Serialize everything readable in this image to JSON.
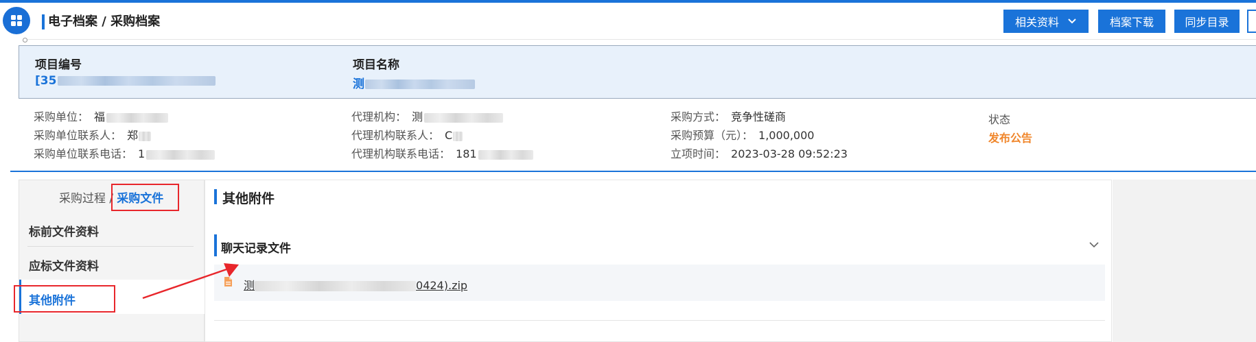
{
  "header": {
    "breadcrumb": "电子档案 / 采购档案",
    "buttons": {
      "related": "相关资料",
      "download": "档案下载",
      "sync": "同步目录"
    }
  },
  "project": {
    "number_label": "项目编号",
    "number_value": "[35",
    "name_label": "项目名称",
    "name_value": "测"
  },
  "info": {
    "purchaser_label": "采购单位：",
    "purchaser_value": "福",
    "purchaser_contact_label": "采购单位联系人：",
    "purchaser_contact_value": "郑",
    "purchaser_phone_label": "采购单位联系电话：",
    "purchaser_phone_value": "1",
    "agency_label": "代理机构：",
    "agency_value": "测",
    "agency_contact_label": "代理机构联系人：",
    "agency_contact_value": "C",
    "agency_phone_label": "代理机构联系电话：",
    "agency_phone_value": "181",
    "method_label": "采购方式：",
    "method_value": "竞争性磋商",
    "budget_label": "采购预算（元）：",
    "budget_value": "1,000,000",
    "date_label": "立项时间：",
    "date_value": "2023-03-28 09:52:23",
    "status_label": "状态",
    "status_value": "发布公告"
  },
  "left_panel": {
    "path": "采购过程 /",
    "active_tab": "采购文件",
    "items": [
      {
        "label": "标前文件资料"
      },
      {
        "label": "应标文件资料"
      },
      {
        "label": "其他附件"
      }
    ]
  },
  "main": {
    "section_title": "其他附件",
    "subsection_title": "聊天记录文件",
    "file_prefix": "测",
    "file_suffix": "0424).zip"
  },
  "colors": {
    "accent": "#1a73d9",
    "status": "#f0862b",
    "highlight_box": "#e8262b"
  }
}
